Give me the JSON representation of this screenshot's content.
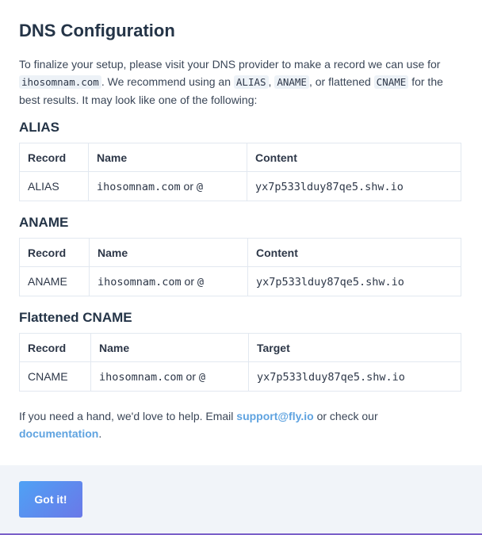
{
  "title": "DNS Configuration",
  "intro": {
    "part1": "To finalize your setup, please visit your DNS provider to make a record we can use for ",
    "domain": "ihosomnam.com",
    "part2": ". We recommend using an ",
    "alias": "ALIAS",
    "comma": ", ",
    "aname": "ANAME",
    "part3": ", or flattened ",
    "cname": "CNAME",
    "part4": " for the best results. It may look like one of the following:"
  },
  "sections": [
    {
      "heading": "ALIAS",
      "headers": [
        "Record",
        "Name",
        "Content"
      ],
      "row": {
        "record": "ALIAS",
        "name": "ihosomnam.com",
        "or": " or ",
        "at": "@",
        "value": "yx7p533lduy87qe5.shw.io"
      }
    },
    {
      "heading": "ANAME",
      "headers": [
        "Record",
        "Name",
        "Content"
      ],
      "row": {
        "record": "ANAME",
        "name": "ihosomnam.com",
        "or": " or ",
        "at": "@",
        "value": "yx7p533lduy87qe5.shw.io"
      }
    },
    {
      "heading": "Flattened CNAME",
      "headers": [
        "Record",
        "Name",
        "Target"
      ],
      "row": {
        "record": "CNAME",
        "name": "ihosomnam.com",
        "or": " or ",
        "at": "@",
        "value": "yx7p533lduy87qe5.shw.io"
      }
    }
  ],
  "help": {
    "part1": "If you need a hand, we'd love to help. Email ",
    "email": "support@fly.io",
    "part2": " or check our ",
    "docs": "documentation",
    "part3": "."
  },
  "button": {
    "label": "Got it!"
  },
  "colors": {
    "accent_start": "#4fa2f5",
    "accent_end": "#6a78e8",
    "link": "#5fa3e0"
  }
}
